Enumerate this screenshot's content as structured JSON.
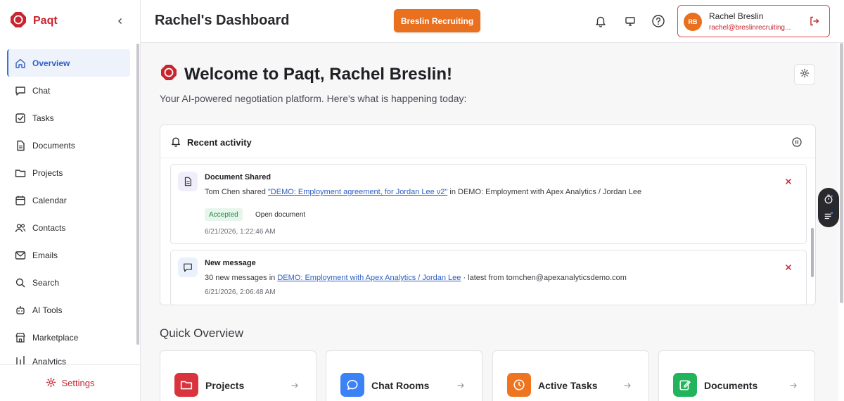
{
  "app": {
    "name": "Paqt",
    "brand_color": "#c8252f",
    "accent_color": "#e8701f",
    "link_color": "#2f5fc5"
  },
  "sidebar": {
    "collapse_icon": "chevron-left-icon",
    "items": [
      {
        "label": "Overview",
        "icon": "home-icon",
        "active": true
      },
      {
        "label": "Chat",
        "icon": "chat-icon"
      },
      {
        "label": "Tasks",
        "icon": "check-square-icon"
      },
      {
        "label": "Documents",
        "icon": "document-icon"
      },
      {
        "label": "Projects",
        "icon": "folder-icon"
      },
      {
        "label": "Calendar",
        "icon": "calendar-icon"
      },
      {
        "label": "Contacts",
        "icon": "users-icon"
      },
      {
        "label": "Emails",
        "icon": "mail-icon"
      },
      {
        "label": "Search",
        "icon": "search-icon"
      },
      {
        "label": "AI Tools",
        "icon": "bot-icon"
      },
      {
        "label": "Marketplace",
        "icon": "store-icon"
      },
      {
        "label": "Analytics",
        "icon": "chart-icon"
      }
    ],
    "settings_label": "Settings"
  },
  "header": {
    "title": "Rachel's Dashboard",
    "org_button": "Breslin Recruiting",
    "user": {
      "initials": "RB",
      "name": "Rachel Breslin",
      "email": "rachel@breslinrecruiting..."
    }
  },
  "welcome": {
    "title": "Welcome to Paqt, Rachel Breslin!",
    "subtitle": "Your AI-powered negotiation platform. Here's what is happening today:"
  },
  "activity": {
    "title": "Recent activity",
    "items": [
      {
        "title": "Document Shared",
        "icon": "document-icon",
        "desc_prefix": "Tom Chen shared ",
        "link": "\"DEMO: Employment agreement, for Jordan Lee v2\"",
        "desc_suffix": " in DEMO: Employment with Apex Analytics / Jordan Lee",
        "status": "Accepted",
        "action": "Open document",
        "time": "6/21/2026, 1:22:46 AM"
      },
      {
        "title": "New message",
        "icon": "message-icon",
        "desc_prefix": "30 new messages in ",
        "link": "DEMO: Employment with Apex Analytics / Jordan Lee",
        "desc_suffix": " · latest from tomchen@apexanalyticsdemo.com",
        "time": "6/21/2026, 2:06:48 AM"
      }
    ]
  },
  "quick_overview": {
    "title": "Quick Overview",
    "cards": [
      {
        "label": "Projects",
        "icon": "folder-icon",
        "color": "#d9343d"
      },
      {
        "label": "Chat Rooms",
        "icon": "chat-icon",
        "color": "#3b82f6"
      },
      {
        "label": "Active Tasks",
        "icon": "clock-icon",
        "color": "#ee7420"
      },
      {
        "label": "Documents",
        "icon": "edit-icon",
        "color": "#22b45a"
      }
    ]
  }
}
